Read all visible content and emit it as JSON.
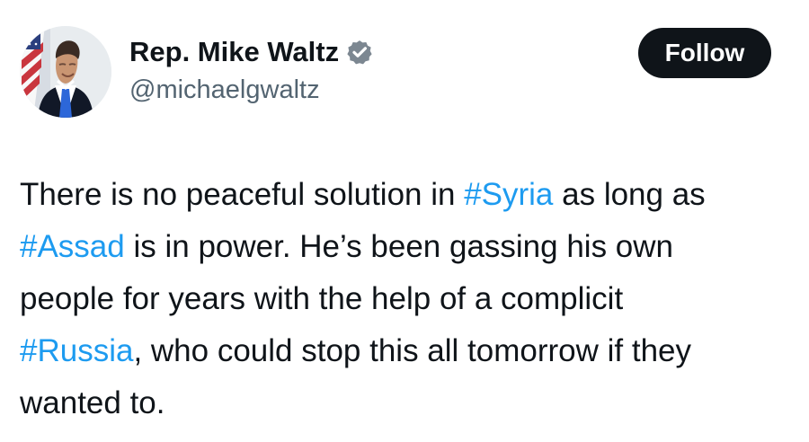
{
  "profile": {
    "display_name": "Rep. Mike Waltz",
    "handle": "@michaelgwaltz",
    "avatar_icon": "profile-photo",
    "verified_icon": "verified-badge-icon"
  },
  "actions": {
    "follow_label": "Follow"
  },
  "tweet": {
    "lines": [
      {
        "a": "There is no peaceful solution in ",
        "tag": "#Syria",
        "b": " as long as"
      },
      {
        "tag": "#Assad",
        "b": " is in power.  He’s been gassing his own"
      },
      {
        "text": "people for years with the help of a complicit"
      },
      {
        "tag": "#Russia",
        "b": ", who could stop this all tomorrow if they"
      },
      {
        "text": "wanted to."
      }
    ]
  },
  "colors": {
    "text": "#0f1419",
    "secondary_text": "#536471",
    "link": "#1d9bf0",
    "follow_button_background": "#0f1419",
    "follow_button_text": "#ffffff",
    "verified_badge": "#7c8791"
  }
}
